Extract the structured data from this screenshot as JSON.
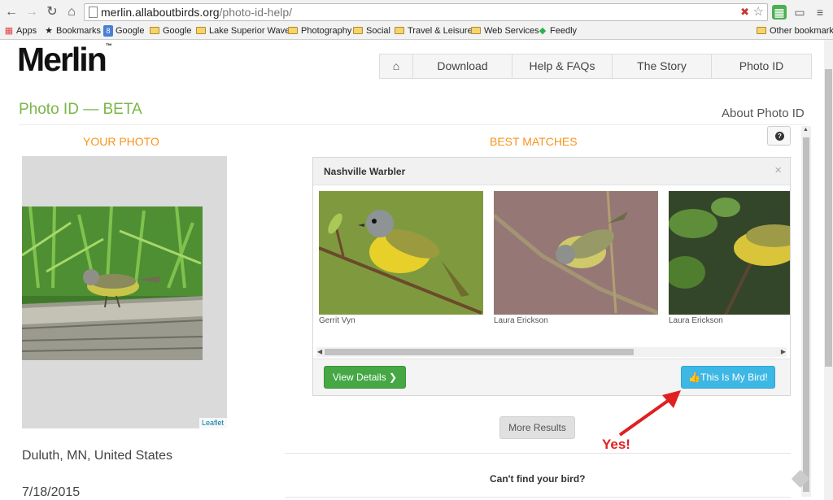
{
  "browser": {
    "url_host": "merlin.allaboutbirds.org",
    "url_path": "/photo-id-help/",
    "bookmarks": [
      {
        "label": "Apps",
        "icon": "apps-grid-icon"
      },
      {
        "label": "Bookmarks",
        "icon": "star-icon"
      },
      {
        "label": "Google",
        "icon": "google-icon"
      },
      {
        "label": "Google",
        "icon": "folder-icon"
      },
      {
        "label": "Lake Superior Waves",
        "icon": "folder-icon"
      },
      {
        "label": "Photography",
        "icon": "folder-icon"
      },
      {
        "label": "Social",
        "icon": "folder-icon"
      },
      {
        "label": "Travel & Leisure",
        "icon": "folder-icon"
      },
      {
        "label": "Web Services",
        "icon": "folder-icon"
      },
      {
        "label": "Feedly",
        "icon": "feedly-icon"
      }
    ],
    "other_bookmarks": "Other bookmarks"
  },
  "site": {
    "logo": "Merlin",
    "logo_tm": "™",
    "nav": [
      "Download",
      "Help & FAQs",
      "The Story",
      "Photo ID"
    ]
  },
  "page": {
    "title": "Photo ID — BETA",
    "about_link": "About Photo ID",
    "your_photo_heading": "YOUR PHOTO",
    "best_matches_heading": "BEST MATCHES",
    "map_attribution": "Leaflet",
    "location": "Duluth, MN, United States",
    "date": "7/18/2015"
  },
  "match": {
    "species": "Nashville Warbler",
    "credits": [
      "Gerrit Vyn",
      "Laura Erickson",
      "Laura Erickson"
    ],
    "view_details": "View Details",
    "this_is_my_bird": "This Is My Bird!"
  },
  "more_results": "More Results",
  "annotation": "Yes!",
  "cant_find": "Can't find your bird?",
  "colors": {
    "brand_green": "#7ab648",
    "heading_orange": "#f7941d",
    "button_green": "#45a845",
    "button_blue": "#3db7e4",
    "annotation_red": "#e02020"
  }
}
